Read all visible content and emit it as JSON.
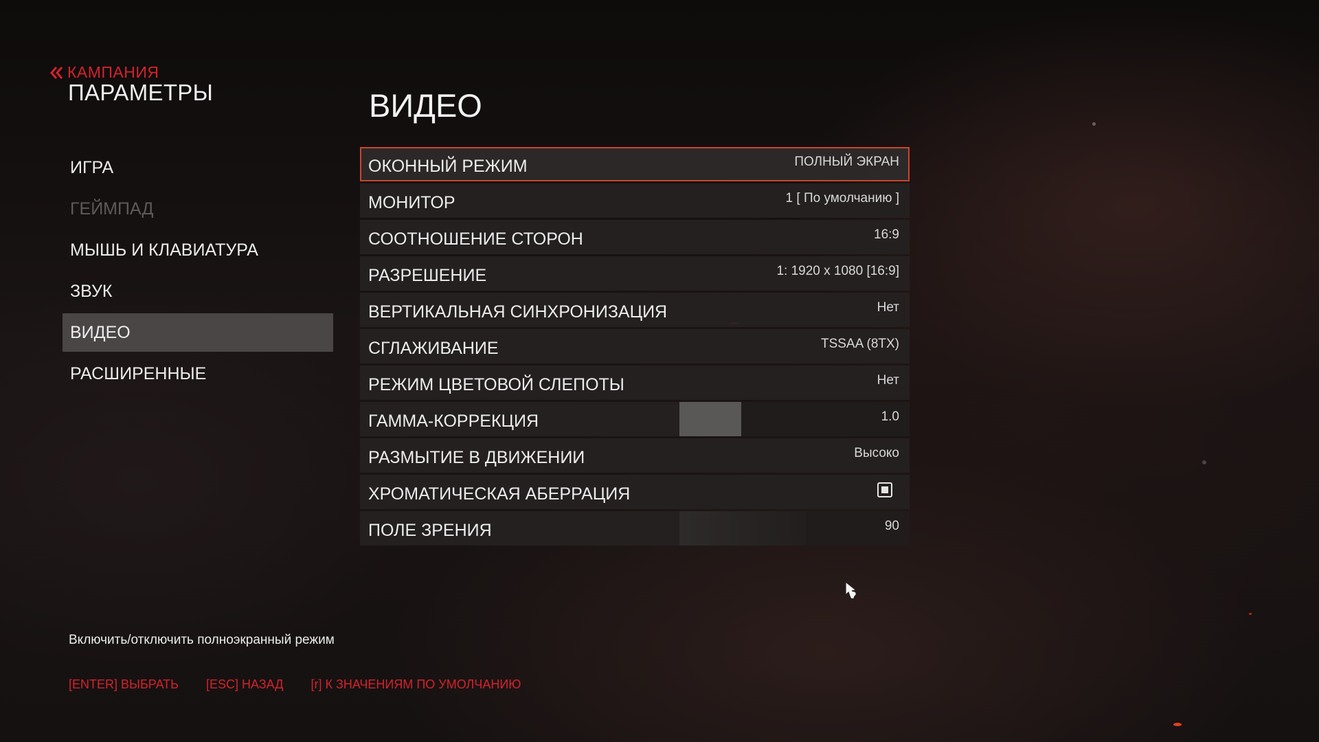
{
  "header": {
    "back_label": "КАМПАНИЯ",
    "title": "ПАРАМЕТРЫ"
  },
  "sidebar": {
    "items": [
      {
        "label": "ИГРА",
        "state": "normal"
      },
      {
        "label": "ГЕЙМПАД",
        "state": "disabled"
      },
      {
        "label": "МЫШЬ И КЛАВИАТУРА",
        "state": "normal"
      },
      {
        "label": "ЗВУК",
        "state": "normal"
      },
      {
        "label": "ВИДЕО",
        "state": "active"
      },
      {
        "label": "РАСШИРЕННЫЕ",
        "state": "normal"
      }
    ]
  },
  "section": {
    "title": "ВИДЕО"
  },
  "settings": [
    {
      "label": "ОКОННЫЙ РЕЖИМ",
      "value": "ПОЛНЫЙ ЭКРАН",
      "kind": "select"
    },
    {
      "label": "МОНИТОР",
      "value": "1 [ По умолчанию ]",
      "kind": "select"
    },
    {
      "label": "СООТНОШЕНИЕ СТОРОН",
      "value": "16:9",
      "kind": "select"
    },
    {
      "label": "РАЗРЕШЕНИЕ",
      "value": "1: 1920 x 1080 [16:9]",
      "kind": "select"
    },
    {
      "label": "ВЕРТИКАЛЬНАЯ СИНХРОНИЗАЦИЯ",
      "value": "Нет",
      "kind": "select"
    },
    {
      "label": "СГЛАЖИВАНИЕ",
      "value": "TSSAA (8TX)",
      "kind": "select"
    },
    {
      "label": "РЕЖИМ ЦВЕТОВОЙ СЛЕПОТЫ",
      "value": "Нет",
      "kind": "select"
    },
    {
      "label": "ГАММА-КОРРЕКЦИЯ",
      "value": "1.0",
      "kind": "slider",
      "fill_fraction": 0.27
    },
    {
      "label": "РАЗМЫТИЕ В ДВИЖЕНИИ",
      "value": "Высоко",
      "kind": "select"
    },
    {
      "label": "ХРОМАТИЧЕСКАЯ АБЕРРАЦИЯ",
      "value": "",
      "kind": "checkbox",
      "checked": true
    },
    {
      "label": "ПОЛЕ ЗРЕНИЯ",
      "value": "90",
      "kind": "slider",
      "fill_fraction": 0.55
    }
  ],
  "selected_setting_index": 0,
  "description": "Включить/отключить полноэкранный режим",
  "footer": {
    "select_hint": "[ENTER] ВЫБРАТЬ",
    "back_hint": "[ESC] НАЗАД",
    "defaults_hint": "[r] К ЗНАЧЕНИЯМ ПО УМОЛЧАНИЮ"
  },
  "colors": {
    "accent_red": "#d4232b",
    "selection_outline": "#c8452d",
    "active_sidebar_bg": "#4a4646"
  },
  "icons": {
    "back": "double-chevron-left-icon",
    "checkbox": "checkbox-checked-icon",
    "cursor": "mouse-cursor-icon"
  }
}
